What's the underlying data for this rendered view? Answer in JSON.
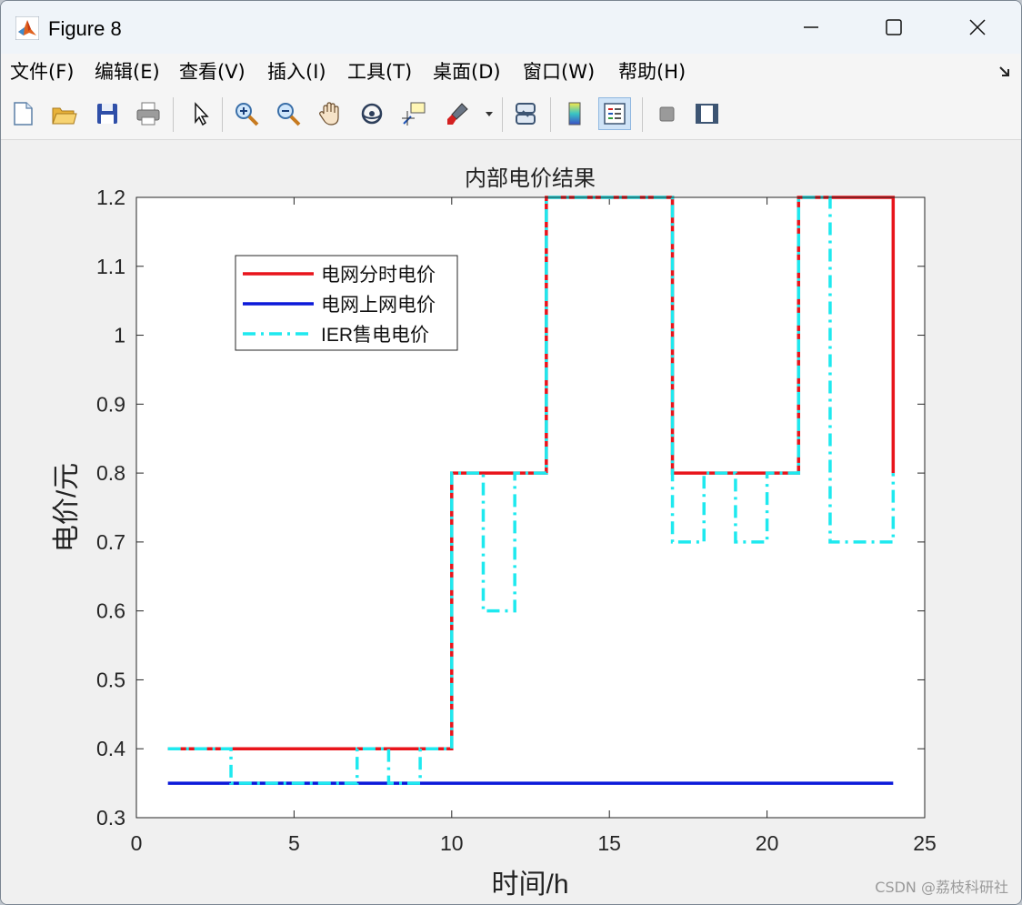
{
  "window": {
    "title": "Figure 8"
  },
  "menu": [
    "文件(F)",
    "编辑(E)",
    "查看(V)",
    "插入(I)",
    "工具(T)",
    "桌面(D)",
    "窗口(W)",
    "帮助(H)"
  ],
  "toolbar": {
    "icons": [
      "new-figure-icon",
      "open-file-icon",
      "save-icon",
      "print-icon",
      "select-arrow-icon",
      "zoom-in-icon",
      "zoom-out-icon",
      "pan-hand-icon",
      "rotate-3d-icon",
      "data-cursor-icon",
      "brush-icon",
      "link-plot-icon",
      "colorbar-icon",
      "legend-icon",
      "hide-plot-tools-icon",
      "show-plot-tools-icon"
    ]
  },
  "watermark": "CSDN @荔枝科研社",
  "chart_data": {
    "type": "line",
    "title": "内部电价结果",
    "xlabel": "时间/h",
    "ylabel": "电价/元",
    "xlim": [
      0,
      25
    ],
    "ylim": [
      0.3,
      1.2
    ],
    "xticks": [
      "0",
      "5",
      "10",
      "15",
      "20",
      "25"
    ],
    "yticks": [
      "0.3",
      "0.4",
      "0.5",
      "0.6",
      "0.7",
      "0.8",
      "0.9",
      "1",
      "1.1",
      "1.2"
    ],
    "grid": false,
    "legend_position": "top-left",
    "step": true,
    "x": [
      1,
      2,
      3,
      4,
      5,
      6,
      7,
      8,
      9,
      10,
      11,
      12,
      13,
      14,
      15,
      16,
      17,
      18,
      19,
      20,
      21,
      22,
      23,
      24
    ],
    "series": [
      {
        "name": "电网分时电价",
        "color": "#e8141b",
        "style": "solid",
        "values": [
          0.4,
          0.4,
          0.4,
          0.4,
          0.4,
          0.4,
          0.4,
          0.4,
          0.4,
          0.8,
          0.8,
          0.8,
          1.2,
          1.2,
          1.2,
          1.2,
          0.8,
          0.8,
          0.8,
          0.8,
          1.2,
          1.2,
          1.2,
          0.8
        ]
      },
      {
        "name": "电网上网电价",
        "color": "#0b19d9",
        "style": "solid",
        "values": [
          0.35,
          0.35,
          0.35,
          0.35,
          0.35,
          0.35,
          0.35,
          0.35,
          0.35,
          0.35,
          0.35,
          0.35,
          0.35,
          0.35,
          0.35,
          0.35,
          0.35,
          0.35,
          0.35,
          0.35,
          0.35,
          0.35,
          0.35,
          0.35
        ]
      },
      {
        "name": "IER售电电价",
        "color": "#1ee9ef",
        "style": "dashdot",
        "values": [
          0.4,
          0.4,
          0.35,
          0.35,
          0.35,
          0.35,
          0.4,
          0.35,
          0.4,
          0.8,
          0.6,
          0.8,
          1.2,
          1.2,
          1.2,
          1.2,
          0.7,
          0.8,
          0.7,
          0.8,
          1.2,
          0.7,
          0.7,
          0.8
        ]
      }
    ]
  }
}
